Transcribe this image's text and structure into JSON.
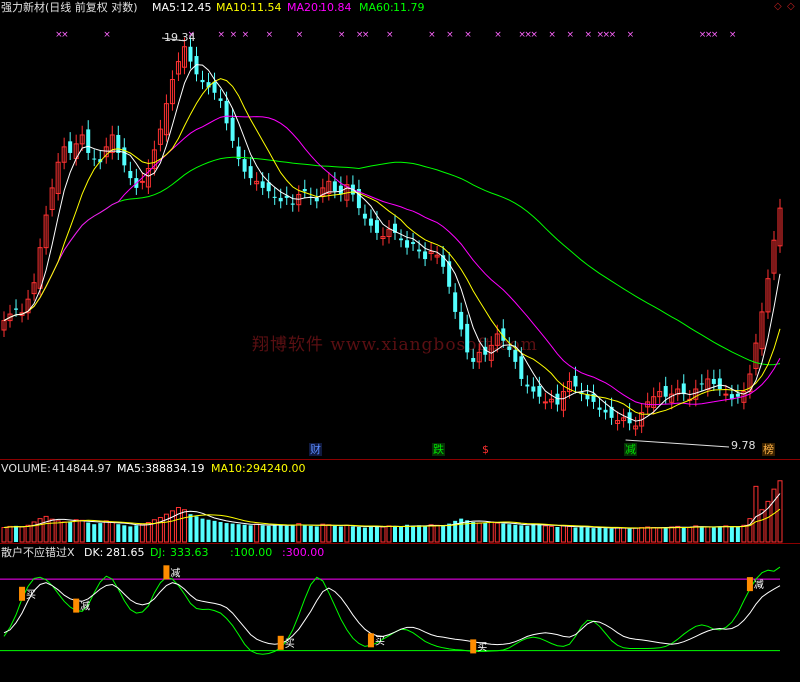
{
  "header": {
    "title": "强力新材(日线 前复权 对数)",
    "ma5_label": "MA5:",
    "ma5_value": "12.45",
    "ma10_label": "MA10:",
    "ma10_value": "11.54",
    "ma20_label": "MA20:",
    "ma20_value": "10.84",
    "ma60_label": "MA60:",
    "ma60_value": "11.79"
  },
  "watermark": "翔博软件 www.xiangbosoft.com",
  "price_annotations": {
    "high": "19.34",
    "low": "9.78"
  },
  "event_tags": {
    "cai": "财",
    "die": "跌",
    "dollar": "$",
    "jian": "减",
    "bang": "榜"
  },
  "volume_panel": {
    "label": "VOLUME:",
    "value": "414844.97",
    "ma5_label": "MA5:",
    "ma5_value": "388834.19",
    "ma10_label": "MA10:",
    "ma10_value": "294240.00"
  },
  "indicator_panel": {
    "name": "散户不应错过X",
    "dk_label": "DK:",
    "dk_value": "281.65",
    "dj_label": "DJ:",
    "dj_value": "333.63",
    "level_low": ":100.00",
    "level_high": ":300.00",
    "buy_label": "买",
    "sell_label": "减"
  },
  "colors": {
    "up": "#ff3232",
    "down": "#54ffff",
    "ma5": "#ffffff",
    "ma10": "#ffff00",
    "ma20": "#ff00ff",
    "ma60": "#00ff00",
    "separator": "#8b0000",
    "marker": "#ff66ff",
    "signal": "#ff8c00"
  },
  "chart_data": {
    "type": "candlestick",
    "bars": 130,
    "price_axis_scale": "log",
    "closes": [
      10.6,
      10.75,
      10.85,
      10.78,
      11.1,
      11.5,
      12.4,
      13.3,
      14.1,
      14.9,
      15.4,
      15.2,
      15.5,
      15.8,
      15.2,
      15.0,
      14.9,
      15.4,
      15.8,
      15.2,
      14.8,
      14.4,
      14.1,
      14.3,
      14.7,
      15.3,
      16.0,
      16.9,
      17.8,
      18.5,
      19.1,
      18.5,
      18.0,
      17.7,
      17.5,
      17.3,
      17.0,
      16.2,
      15.6,
      15.0,
      14.6,
      14.4,
      14.3,
      14.1,
      14.0,
      13.8,
      13.7,
      13.8,
      13.6,
      13.9,
      14.0,
      13.8,
      13.7,
      14.1,
      14.3,
      14.0,
      13.9,
      14.2,
      13.9,
      13.5,
      13.2,
      13.0,
      12.8,
      12.7,
      12.9,
      12.8,
      12.6,
      12.4,
      12.5,
      12.3,
      12.1,
      12.3,
      12.2,
      11.9,
      11.4,
      10.8,
      10.4,
      9.9,
      9.7,
      9.9,
      9.85,
      10.05,
      10.3,
      10.15,
      9.95,
      9.7,
      9.35,
      9.2,
      9.1,
      9.0,
      8.9,
      8.95,
      8.85,
      9.1,
      9.3,
      9.2,
      9.05,
      8.95,
      8.9,
      8.75,
      8.7,
      8.6,
      8.55,
      8.6,
      8.5,
      8.45,
      8.7,
      8.9,
      9.0,
      9.1,
      9.0,
      9.05,
      9.15,
      9.05,
      8.95,
      9.15,
      9.25,
      9.35,
      9.25,
      9.15,
      9.05,
      8.95,
      9.0,
      9.1,
      9.45,
      10.1,
      10.8,
      11.6,
      12.6,
      13.5
    ],
    "series": [
      {
        "name": "MA5",
        "value": 12.45
      },
      {
        "name": "MA10",
        "value": 11.54
      },
      {
        "name": "MA20",
        "value": 10.84
      },
      {
        "name": "MA60",
        "value": 11.79
      }
    ],
    "high_label": 19.34,
    "low_label": 9.78,
    "volume": {
      "values": [
        2.6,
        2.8,
        2.9,
        2.7,
        3.0,
        3.6,
        4.2,
        4.6,
        4.1,
        3.8,
        3.6,
        3.7,
        4.0,
        3.9,
        3.5,
        3.2,
        3.4,
        3.8,
        3.6,
        3.2,
        3.0,
        2.8,
        3.0,
        3.2,
        3.5,
        4.0,
        4.4,
        5.0,
        5.6,
        6.2,
        5.8,
        5.0,
        4.6,
        4.2,
        4.0,
        3.8,
        3.6,
        3.4,
        3.3,
        3.2,
        3.1,
        3.0,
        3.2,
        3.0,
        2.9,
        3.1,
        3.0,
        2.9,
        3.1,
        3.3,
        3.0,
        2.9,
        2.8,
        3.2,
        3.1,
        2.9,
        2.8,
        3.0,
        2.8,
        2.7,
        2.6,
        2.9,
        2.8,
        2.7,
        2.9,
        2.8,
        2.7,
        3.1,
        2.9,
        3.0,
        2.8,
        3.1,
        3.0,
        2.9,
        3.3,
        3.8,
        4.2,
        3.9,
        3.6,
        3.4,
        3.5,
        3.6,
        3.4,
        3.3,
        3.2,
        3.1,
        3.0,
        2.9,
        3.3,
        3.2,
        2.9,
        2.8,
        2.7,
        2.9,
        2.8,
        2.6,
        2.7,
        2.6,
        2.5,
        2.6,
        2.5,
        2.4,
        2.6,
        2.5,
        2.4,
        2.5,
        2.6,
        2.7,
        2.6,
        2.5,
        2.6,
        2.7,
        2.8,
        2.7,
        2.6,
        2.9,
        2.8,
        2.7,
        2.6,
        2.8,
        2.9,
        2.8,
        2.7,
        3.0,
        4.2,
        10.0,
        5.8,
        7.3,
        9.5,
        11.0
      ],
      "value": 414844.97,
      "ma5": 388834.19,
      "ma10": 294240.0
    },
    "indicator": {
      "dk_last": 281.65,
      "dj_last": 333.63,
      "levels": [
        100,
        300
      ],
      "dk": [
        150,
        158,
        178,
        205,
        240,
        268,
        285,
        290,
        282,
        270,
        255,
        245,
        240,
        238,
        245,
        258,
        272,
        282,
        285,
        275,
        258,
        242,
        232,
        228,
        232,
        245,
        265,
        282,
        290,
        285,
        272,
        255,
        242,
        238,
        235,
        232,
        228,
        220,
        205,
        185,
        165,
        145,
        132,
        125,
        120,
        118,
        120,
        128,
        142,
        160,
        185,
        210,
        240,
        265,
        275,
        265,
        248,
        225,
        200,
        178,
        160,
        148,
        142,
        140,
        145,
        152,
        160,
        165,
        165,
        160,
        152,
        145,
        140,
        138,
        135,
        132,
        130,
        128,
        125,
        122,
        120,
        118,
        117,
        118,
        120,
        125,
        132,
        140,
        145,
        148,
        150,
        148,
        145,
        140,
        138,
        145,
        160,
        175,
        182,
        180,
        172,
        162,
        150,
        140,
        135,
        132,
        130,
        128,
        125,
        122,
        120,
        118,
        120,
        125,
        132,
        140,
        148,
        155,
        160,
        162,
        160,
        162,
        170,
        185,
        205,
        230,
        250,
        262,
        272,
        281.65
      ],
      "dj": [
        140,
        165,
        200,
        245,
        280,
        302,
        305,
        298,
        282,
        260,
        238,
        222,
        212,
        210,
        228,
        262,
        292,
        308,
        300,
        272,
        240,
        215,
        205,
        208,
        225,
        262,
        290,
        305,
        300,
        282,
        258,
        232,
        218,
        215,
        216,
        212,
        205,
        190,
        170,
        145,
        118,
        100,
        92,
        90,
        92,
        98,
        108,
        128,
        158,
        200,
        245,
        285,
        305,
        295,
        262,
        225,
        188,
        158,
        135,
        120,
        112,
        115,
        122,
        132,
        142,
        152,
        160,
        158,
        150,
        138,
        126,
        118,
        112,
        108,
        105,
        103,
        102,
        100,
        98,
        98,
        98,
        99,
        100,
        102,
        108,
        118,
        128,
        135,
        138,
        135,
        128,
        120,
        114,
        112,
        118,
        140,
        168,
        185,
        182,
        168,
        148,
        128,
        115,
        108,
        106,
        106,
        106,
        106,
        107,
        108,
        112,
        120,
        132,
        146,
        158,
        168,
        172,
        168,
        160,
        158,
        165,
        180,
        205,
        240,
        272,
        300,
        318,
        325,
        322,
        333.63
      ],
      "signals": [
        {
          "label": "买",
          "bar": 3
        },
        {
          "label": "减",
          "bar": 12
        },
        {
          "label": "减",
          "bar": 27
        },
        {
          "label": "买",
          "bar": 46
        },
        {
          "label": "买",
          "bar": 61
        },
        {
          "label": "买",
          "bar": 78
        },
        {
          "label": "减",
          "bar": 124
        }
      ]
    }
  }
}
